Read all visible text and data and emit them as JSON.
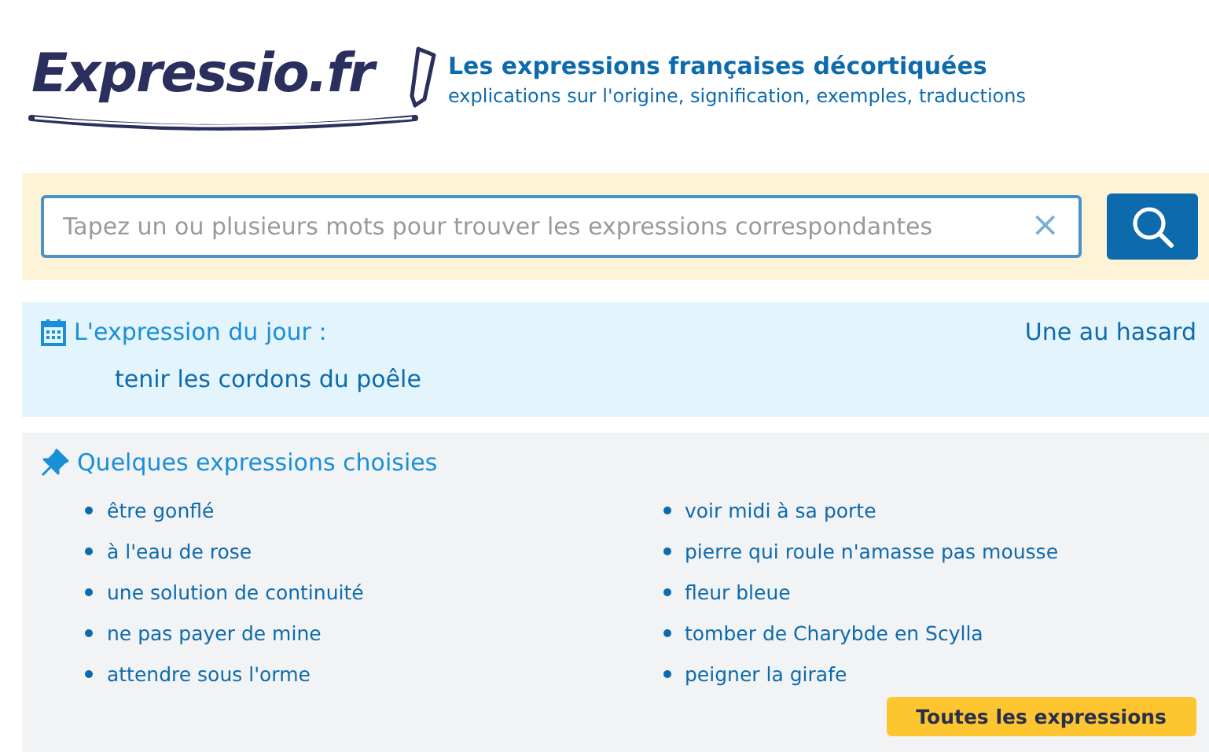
{
  "header": {
    "logo": "Expressio.fr",
    "title": "Les expressions françaises décortiquées",
    "subtitle": "explications sur l'origine, signification, exemples, traductions"
  },
  "search": {
    "placeholder": "Tapez un ou plusieurs mots pour trouver les expressions correspondantes",
    "clear": "×"
  },
  "day": {
    "heading": "L'expression du jour :",
    "random_link": "Une au hasard",
    "expression": "tenir les cordons du poêle"
  },
  "chosen": {
    "heading": "Quelques expressions choisies",
    "columns": [
      [
        "être gonflé",
        "à l'eau de rose",
        "une solution de continuité",
        "ne pas payer de mine",
        "attendre sous l'orme"
      ],
      [
        "voir midi à sa porte",
        "pierre qui roule n'amasse pas mousse",
        "fleur bleue",
        "tomber de Charybde en Scylla",
        "peigner la girafe"
      ]
    ],
    "all_button": "Toutes les expressions"
  }
}
